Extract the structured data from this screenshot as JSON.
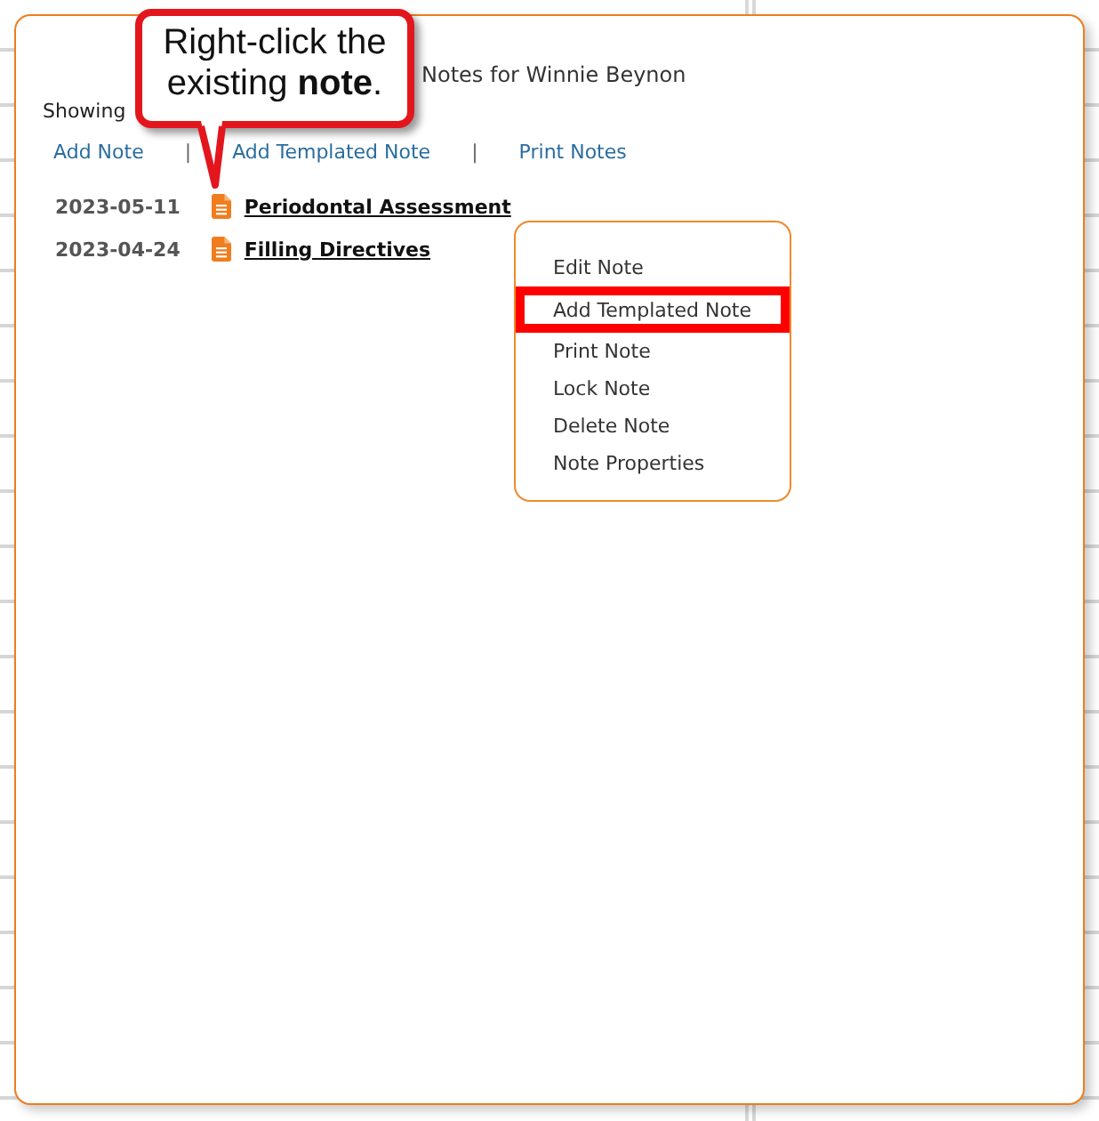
{
  "panel": {
    "title": "Notes for Winnie Beynon",
    "showing": "Showing"
  },
  "toolbar": [
    {
      "kind": "link",
      "label": "Add Note"
    },
    {
      "kind": "separator",
      "label": "|"
    },
    {
      "kind": "link",
      "label": "Add Templated Note"
    },
    {
      "kind": "separator",
      "label": "|"
    },
    {
      "kind": "link",
      "label": "Print Notes"
    }
  ],
  "notes": [
    {
      "date": "2023-05-11",
      "title": "Periodontal Assessment"
    },
    {
      "date": "2023-04-24",
      "title": "Filling Directives"
    }
  ],
  "context_menu": {
    "items": [
      {
        "label": "Edit Note",
        "selected": false
      },
      {
        "label": "Add Templated Note",
        "selected": true
      },
      {
        "label": "Print Note",
        "selected": false
      },
      {
        "label": "Lock Note",
        "selected": false
      },
      {
        "label": "Delete Note",
        "selected": false
      },
      {
        "label": "Note Properties",
        "selected": false
      }
    ]
  },
  "callout": {
    "text": "Right-click the existing **note**."
  }
}
